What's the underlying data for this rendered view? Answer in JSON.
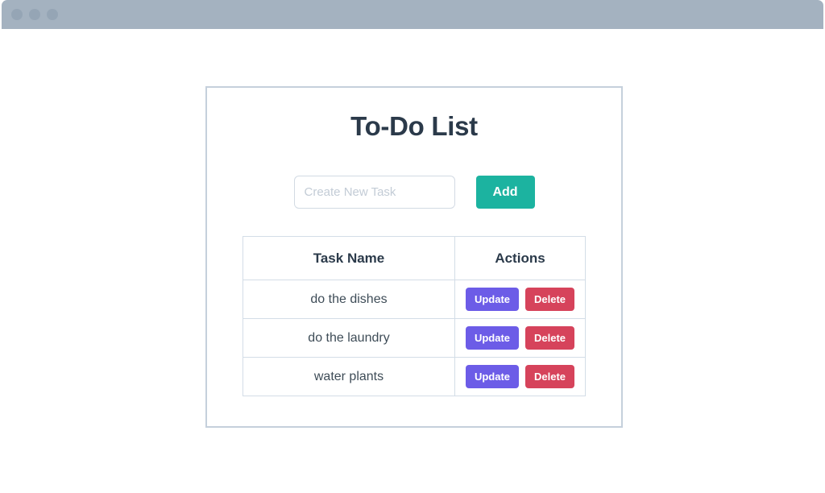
{
  "browser": {
    "chrome_color": "#a4b2c0",
    "dots": [
      "window-dot-1",
      "window-dot-2",
      "window-dot-3"
    ]
  },
  "card": {
    "title": "To-Do List",
    "title_color": "#2b3a4a",
    "border_color": "#c5d0dc"
  },
  "create": {
    "input_value": "",
    "input_placeholder": "Create New Task",
    "add_label": "Add",
    "add_color": "#1cb3a0"
  },
  "table": {
    "headers": [
      "Task Name",
      "Actions"
    ],
    "border_color": "#d3dde7",
    "update_label": "Update",
    "delete_label": "Delete",
    "update_color": "#6c5ce7",
    "delete_color": "#d6435b",
    "rows": [
      {
        "name": "do the dishes",
        "update": "Update",
        "delete": "Delete"
      },
      {
        "name": "do the laundry",
        "update": "Update",
        "delete": "Delete"
      },
      {
        "name": "water plants",
        "update": "Update",
        "delete": "Delete"
      }
    ]
  }
}
